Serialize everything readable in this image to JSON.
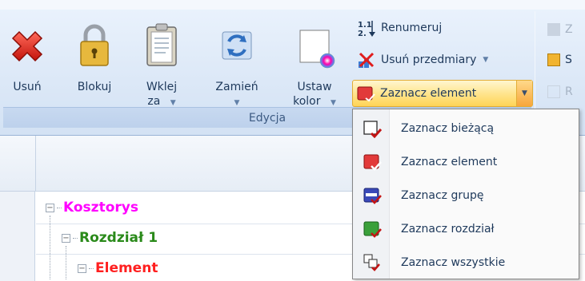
{
  "ribbon": {
    "group_label": "Edycja",
    "buttons": {
      "usun": "Usuń",
      "blokuj": "Blokuj",
      "wklej_line1": "Wklej",
      "wklej_line2": "za",
      "zamien": "Zamień",
      "ustaw_line1": "Ustaw",
      "ustaw_line2": "kolor"
    },
    "small": {
      "renumeruj": "Renumeruj",
      "usun_przedmiary": "Usuń przedmiary",
      "zaznacz_element": "Zaznacz element"
    },
    "right_group": {
      "item1": "Z",
      "item2": "S",
      "item3": "R"
    }
  },
  "menu": {
    "items": [
      {
        "label": "Zaznacz bieżącą",
        "icon": "select-current-icon",
        "color": "#ffffff"
      },
      {
        "label": "Zaznacz element",
        "icon": "select-element-icon",
        "color": "#e23a3a"
      },
      {
        "label": "Zaznacz grupę",
        "icon": "select-group-icon",
        "color": "#3a49b8"
      },
      {
        "label": "Zaznacz rozdział",
        "icon": "select-chapter-icon",
        "color": "#3aa03a"
      },
      {
        "label": "Zaznacz wszystkie",
        "icon": "select-all-icon",
        "color": "#ffffff"
      }
    ]
  },
  "tree": {
    "kosztorys": "Kosztorys",
    "rozdzial": "Rozdział 1",
    "element": "Element"
  },
  "colors": {
    "kosztorys": "#ff00ff",
    "rozdzial": "#2a8a1a",
    "element": "#ff1f1f",
    "highlight": "#ffd456"
  }
}
